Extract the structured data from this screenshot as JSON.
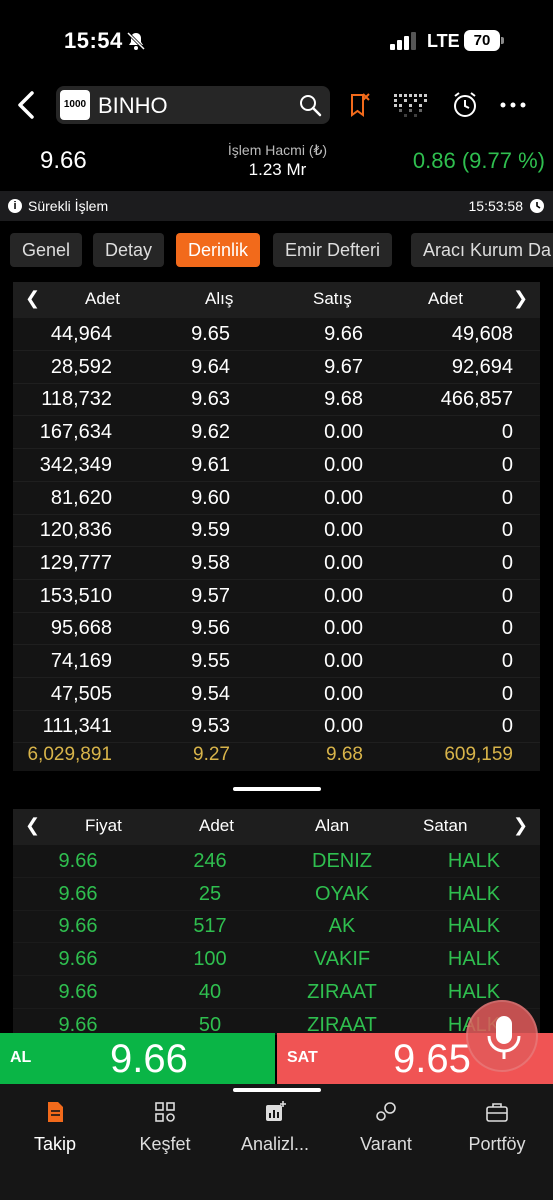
{
  "status_bar": {
    "time": "15:54",
    "network": "LTE",
    "battery": "70"
  },
  "header": {
    "logo_text": "1000",
    "symbol": "BINHO"
  },
  "price_info": {
    "last_price": "9.66",
    "volume_label": "İşlem Hacmi (₺)",
    "volume_value": "1.23 Mr",
    "change": "0.86 (9.77 %)"
  },
  "session": {
    "label": "Sürekli İşlem",
    "time": "15:53:58"
  },
  "tabs": [
    "Genel",
    "Detay",
    "Derinlik",
    "Emir Defteri",
    "Aracı Kurum Da"
  ],
  "active_tab": "Derinlik",
  "depth": {
    "headers": [
      "Adet",
      "Alış",
      "Satış",
      "Adet"
    ],
    "rows": [
      [
        "44,964",
        "9.65",
        "9.66",
        "49,608"
      ],
      [
        "28,592",
        "9.64",
        "9.67",
        "92,694"
      ],
      [
        "118,732",
        "9.63",
        "9.68",
        "466,857"
      ],
      [
        "167,634",
        "9.62",
        "0.00",
        "0"
      ],
      [
        "342,349",
        "9.61",
        "0.00",
        "0"
      ],
      [
        "81,620",
        "9.60",
        "0.00",
        "0"
      ],
      [
        "120,836",
        "9.59",
        "0.00",
        "0"
      ],
      [
        "129,777",
        "9.58",
        "0.00",
        "0"
      ],
      [
        "153,510",
        "9.57",
        "0.00",
        "0"
      ],
      [
        "95,668",
        "9.56",
        "0.00",
        "0"
      ],
      [
        "74,169",
        "9.55",
        "0.00",
        "0"
      ],
      [
        "47,505",
        "9.54",
        "0.00",
        "0"
      ],
      [
        "111,341",
        "9.53",
        "0.00",
        "0"
      ]
    ],
    "totals": [
      "6,029,891",
      "9.27",
      "9.68",
      "609,159"
    ]
  },
  "trades": {
    "headers": [
      "Fiyat",
      "Adet",
      "Alan",
      "Satan"
    ],
    "rows": [
      [
        "9.66",
        "246",
        "DENIZ",
        "HALK"
      ],
      [
        "9.66",
        "25",
        "OYAK",
        "HALK"
      ],
      [
        "9.66",
        "517",
        "AK",
        "HALK"
      ],
      [
        "9.66",
        "100",
        "VAKIF",
        "HALK"
      ],
      [
        "9.66",
        "40",
        "ZIRAAT",
        "HALK"
      ],
      [
        "9.66",
        "50",
        "ZIRAAT",
        "HALK"
      ]
    ]
  },
  "order_buttons": {
    "buy_label": "AL",
    "buy_price": "9.66",
    "sell_label": "SAT",
    "sell_price": "9.65"
  },
  "bottom_nav": [
    "Takip",
    "Keşfet",
    "Analizl...",
    "Varant",
    "Portföy"
  ],
  "colors": {
    "accent": "#f26a1b",
    "up": "#2fbf4f",
    "buy": "#0ab546",
    "sell": "#f05454",
    "total": "#d8b44a"
  }
}
